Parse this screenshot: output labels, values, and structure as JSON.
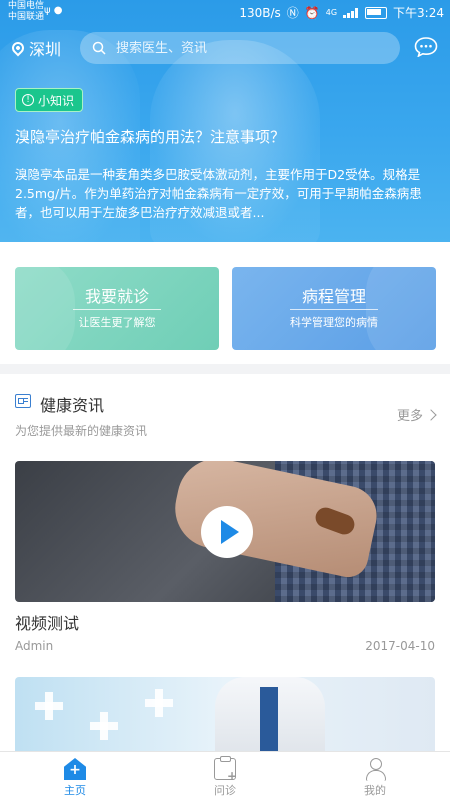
{
  "status_bar": {
    "carrier1": "中国电信",
    "carrier2": "中国联通",
    "speed": "130B/s",
    "network": "4G",
    "time": "下午3:24"
  },
  "header": {
    "city": "深圳",
    "search_placeholder": "搜索医生、资讯",
    "icons": [
      "location-pin-icon",
      "search-icon",
      "message-icon"
    ]
  },
  "tip": {
    "badge": "小知识",
    "title": "溴隐亭治疗帕金森病的用法？注意事项？",
    "description": "溴隐亭本品是一种麦角类多巴胺受体激动剂，主要作用于D2受体。规格是2.5mg/片。作为单药治疗对帕金森病有一定疗效，可用于早期帕金森病患者，也可以用于左旋多巴治疗疗效减退或者..."
  },
  "services": [
    {
      "title": "我要就诊",
      "subtitle": "让医生更了解您",
      "color": "#7dd5bf"
    },
    {
      "title": "病程管理",
      "subtitle": "科学管理您的病情",
      "color": "#6aa9ea"
    }
  ],
  "news_section": {
    "title": "健康资讯",
    "subtitle": "为您提供最新的健康资讯",
    "more": "更多"
  },
  "articles": [
    {
      "title": "视频测试",
      "author": "Admin",
      "date": "2017-04-10",
      "type": "video"
    }
  ],
  "tabbar": {
    "items": [
      {
        "label": "主页",
        "icon": "home-icon",
        "active": true
      },
      {
        "label": "问诊",
        "icon": "consult-clipboard-icon",
        "active": false
      },
      {
        "label": "我的",
        "icon": "user-icon",
        "active": false
      }
    ],
    "active_color": "#1e8ae6"
  }
}
